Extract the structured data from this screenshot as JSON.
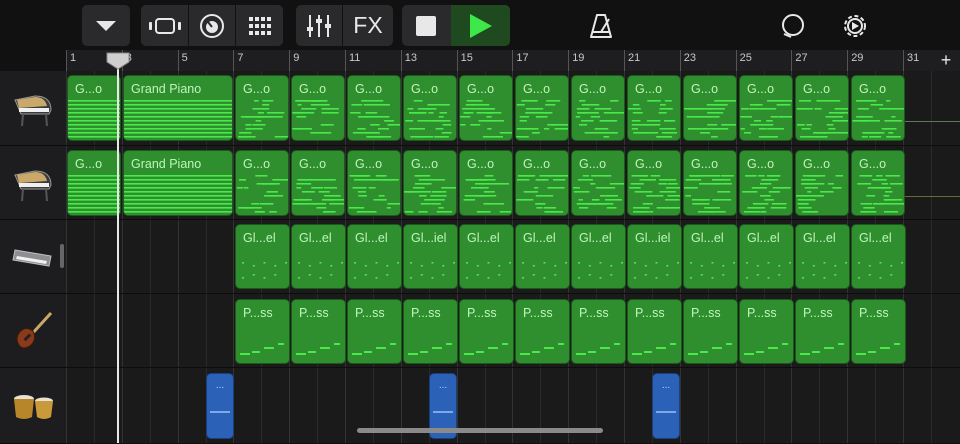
{
  "toolbar": {
    "buttons": [
      {
        "name": "browser-toggle",
        "icon": "chevron-down-icon"
      },
      {
        "name": "tracks-view",
        "icon": "tracks-view-icon"
      },
      {
        "name": "smart-controls",
        "icon": "knob-icon"
      },
      {
        "name": "instrument-grid",
        "icon": "grid-icon"
      },
      {
        "name": "mixer",
        "icon": "sliders-icon"
      },
      {
        "name": "fx",
        "icon": "fx-icon",
        "label": "FX"
      },
      {
        "name": "stop",
        "icon": "stop-icon"
      },
      {
        "name": "play",
        "icon": "play-icon"
      },
      {
        "name": "metronome",
        "icon": "metronome-icon"
      },
      {
        "name": "loop-browser",
        "icon": "loop-icon"
      },
      {
        "name": "settings",
        "icon": "gear-icon"
      }
    ],
    "fx_label": "FX",
    "colors": {
      "play": "#3ee84b",
      "active_bg": "#1f4a1f",
      "group_bg": "#2a2a2c"
    }
  },
  "ruler": {
    "bars": [
      "1",
      "3",
      "5",
      "7",
      "9",
      "11",
      "13",
      "15",
      "17",
      "19",
      "21",
      "23",
      "25",
      "27",
      "29",
      "31"
    ],
    "add_label": "+"
  },
  "tracks": [
    {
      "name": "piano-1",
      "icon": "grand-piano-icon"
    },
    {
      "name": "piano-2",
      "icon": "grand-piano-icon"
    },
    {
      "name": "keyboard",
      "icon": "keyboard-icon"
    },
    {
      "name": "bass",
      "icon": "bass-guitar-icon"
    },
    {
      "name": "drums",
      "icon": "bongo-drums-icon"
    }
  ],
  "regions": {
    "piano": [
      "G...o",
      "Grand Piano",
      "G...o",
      "G...o",
      "G...o",
      "G...o",
      "G...o",
      "G...o",
      "G...o",
      "G...o",
      "G...o",
      "G...o",
      "G...o",
      "G...o"
    ],
    "keys": [
      "Gl...el",
      "Gl...el",
      "Gl...el",
      "Gl...iel",
      "Gl...el",
      "Gl...el",
      "Gl...el",
      "Gl...iel",
      "Gl...el",
      "Gl...el",
      "Gl...el",
      "Gl...el"
    ],
    "bass": [
      "P...ss",
      "P...ss",
      "P...ss",
      "P...ss",
      "P...ss",
      "P...ss",
      "P...ss",
      "P...ss",
      "P...ss",
      "P...ss",
      "P...ss",
      "P...ss"
    ],
    "drums": [
      "...",
      "...",
      "..."
    ]
  },
  "colors": {
    "region_green": "#2f8f2f",
    "note_green": "#49e94a",
    "drum_blue": "#2b62b8"
  }
}
